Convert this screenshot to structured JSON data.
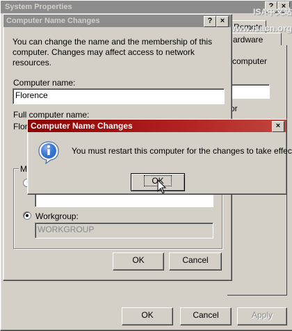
{
  "system_properties": {
    "title": "System Properties",
    "help_btn": "?",
    "close_btn": "×",
    "tabs": {
      "remote": "Remote",
      "hardware": "ardware"
    },
    "partial_texts": {
      "computer": "computer",
      "or": "or"
    },
    "buttons": {
      "ok": "OK",
      "cancel": "Cancel",
      "apply": "Apply"
    }
  },
  "watermark": {
    "line1": "ISA中文站",
    "line2": "http://www.isacn.org"
  },
  "name_changes": {
    "title": "Computer Name Changes",
    "help_btn": "?",
    "close_btn": "×",
    "description": "You can change the name and the membership of this computer. Changes may affect access to network resources.",
    "computer_name_label": "Computer name:",
    "computer_name_value": "Florence",
    "full_name_label": "Full computer name:",
    "full_name_value": "Flore",
    "member_of_label": "Me",
    "workgroup_label": "Workgroup:",
    "workgroup_value": "WORKGROUP",
    "buttons": {
      "ok": "OK",
      "cancel": "Cancel"
    }
  },
  "restart_dialog": {
    "title": "Computer Name Changes",
    "close_btn": "×",
    "icon": "info-icon",
    "message": "You must restart this computer for the changes to take effect.",
    "ok_label": "OK"
  }
}
